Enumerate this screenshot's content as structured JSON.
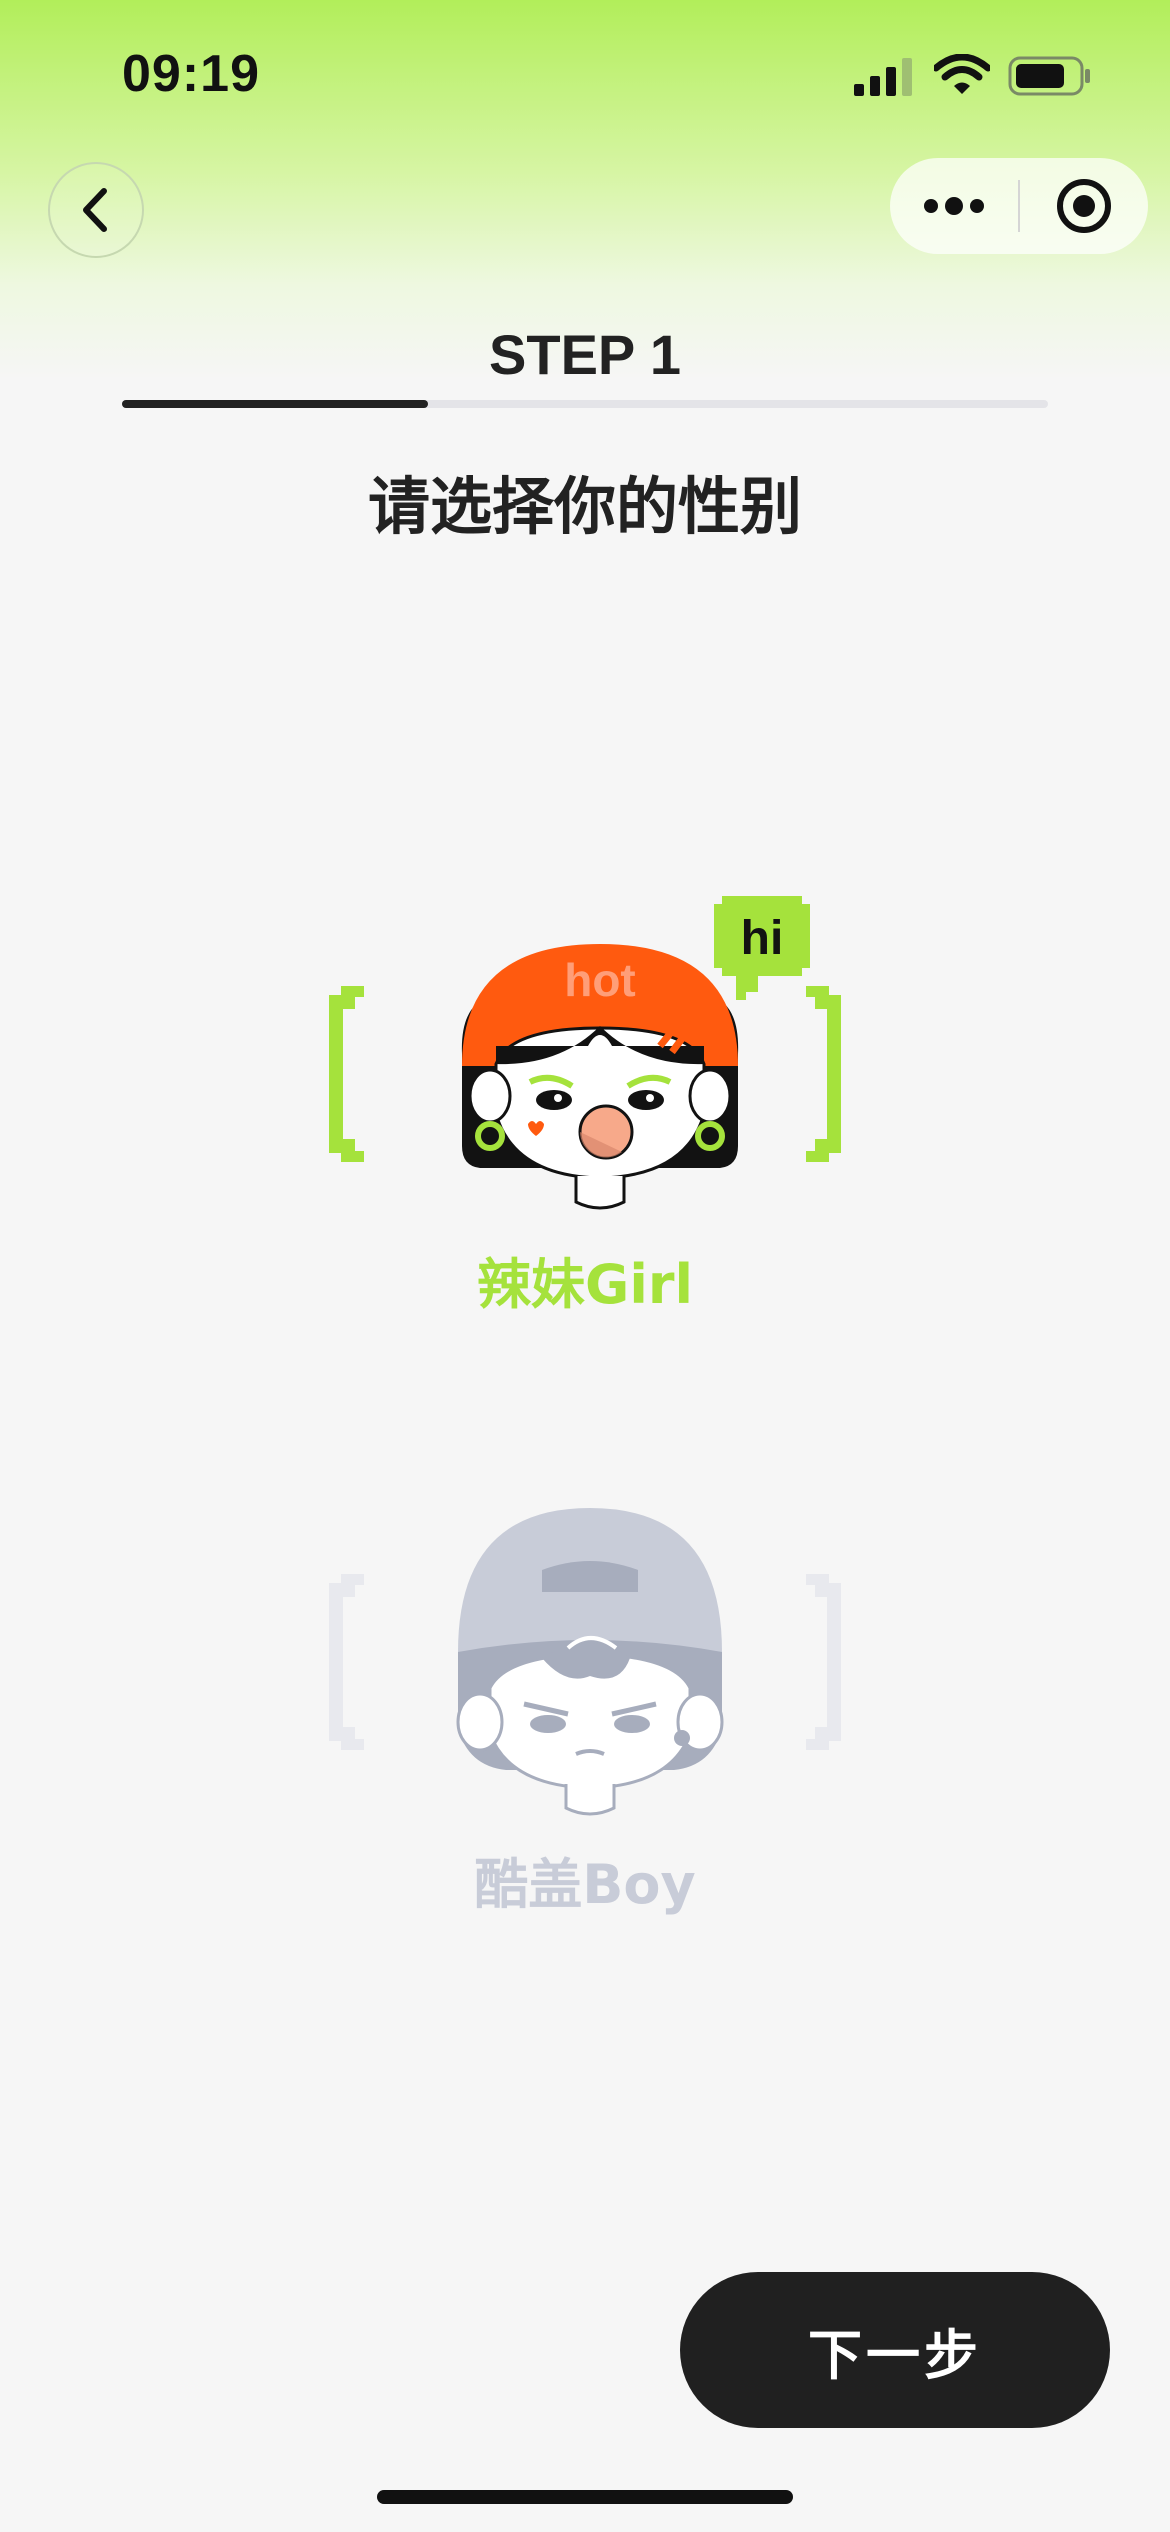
{
  "status_bar": {
    "time": "09:19"
  },
  "nav": {
    "back_icon": "chevron-left-icon",
    "more_icon": "more-dots-icon",
    "target_icon": "target-icon"
  },
  "step": {
    "title": "STEP 1",
    "progress": 0.33
  },
  "question": "请选择你的性别",
  "options": [
    {
      "label": "辣妹Girl",
      "selected": true,
      "hat_text": "hot",
      "bubble_text": "hi",
      "color": "#a5e23c"
    },
    {
      "label": "酷盖Boy",
      "selected": false,
      "color": "#c8ccd8"
    }
  ],
  "footer": {
    "next_label": "下一步"
  },
  "colors": {
    "accent": "#a5e23c",
    "hat": "#ff5a0f",
    "dark": "#202020",
    "muted": "#c8ccd8"
  }
}
